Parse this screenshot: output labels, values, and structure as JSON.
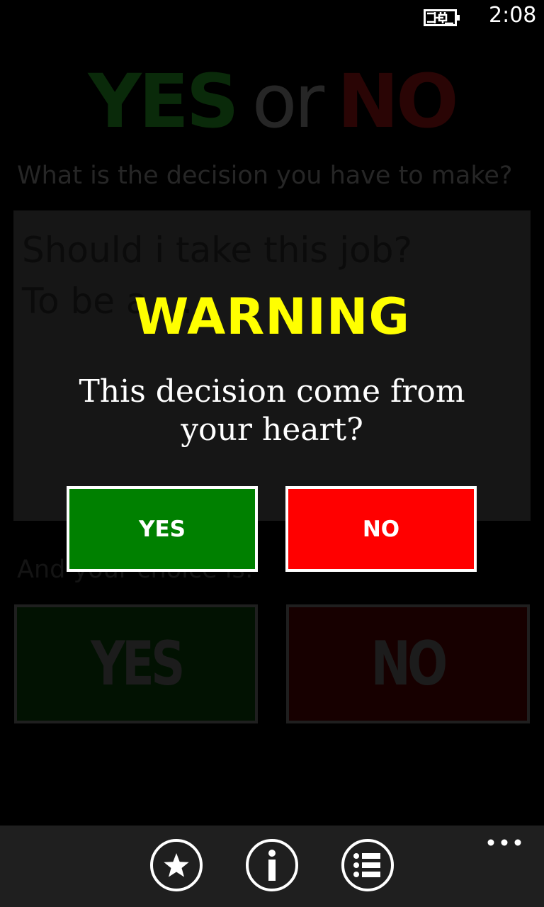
{
  "status_bar": {
    "time": "2:08",
    "battery_icon": "battery-charging-icon"
  },
  "app": {
    "title_yes": "YES",
    "title_or": "or",
    "title_no": "NO",
    "question_label": "What is the decision you have to make?",
    "decision_text": "Should i take this job?\nTo be a ...",
    "choice_label": "And your choice is:",
    "choice_yes": "YES",
    "choice_no": "NO"
  },
  "dialog": {
    "title": "WARNING",
    "message": "This decision come from your heart?",
    "yes_label": "YES",
    "no_label": "NO"
  },
  "app_bar": {
    "buttons": [
      {
        "icon": "star-icon"
      },
      {
        "icon": "info-icon"
      },
      {
        "icon": "list-icon"
      }
    ],
    "more_icon": "more-icon"
  },
  "colors": {
    "dialog_title": "#ffff00",
    "yes_button": "#008000",
    "no_button": "#ff0000",
    "app_bar": "#1f1f1f"
  }
}
